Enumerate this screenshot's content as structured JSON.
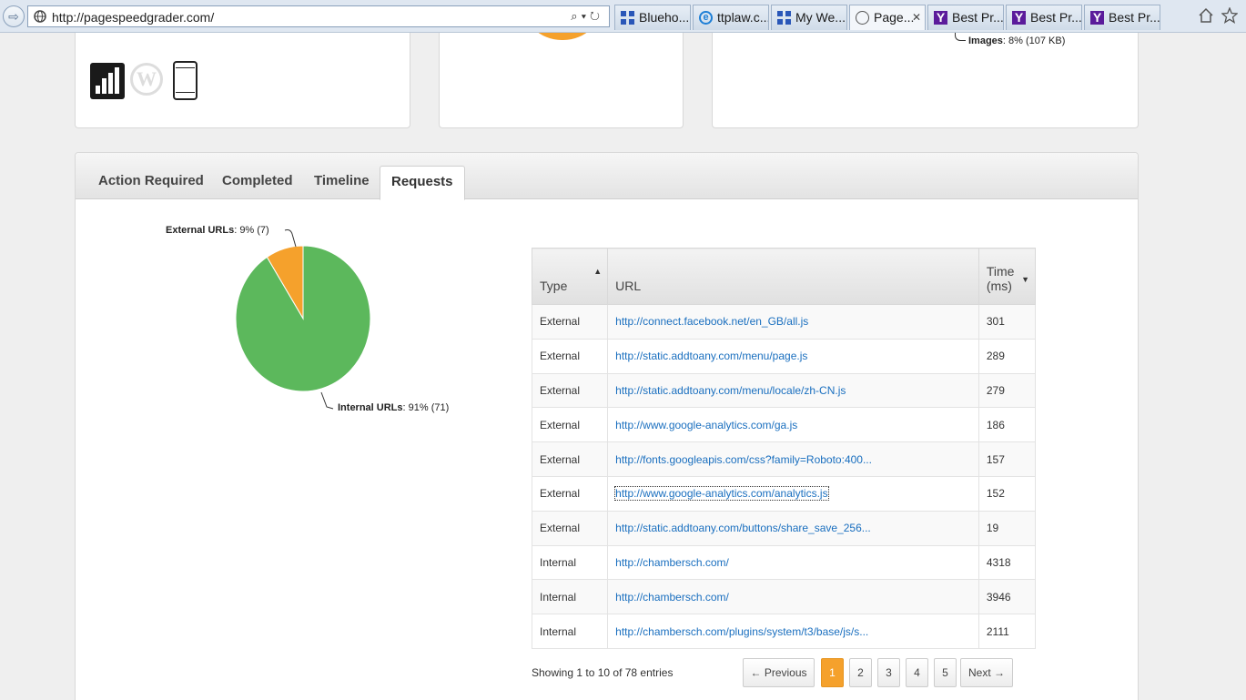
{
  "browser": {
    "address": "http://pagespeedgrader.com/",
    "tabs": [
      {
        "label": "Blueho...",
        "icon": "grid-icon"
      },
      {
        "label": "ttplaw.c...",
        "icon": "ie-icon"
      },
      {
        "label": "My We...",
        "icon": "grid-icon"
      },
      {
        "label": "Page...",
        "icon": "globe-icon",
        "active": true
      },
      {
        "label": "Best Pr...",
        "icon": "yahoo-icon"
      },
      {
        "label": "Best Pr...",
        "icon": "yahoo-icon"
      },
      {
        "label": "Best Pr...",
        "icon": "yahoo-icon"
      }
    ]
  },
  "top_cards": {
    "images_label_bold": "Images",
    "images_label_value": ": 8% (107 KB)"
  },
  "panel": {
    "tabs": [
      "Action Required",
      "Completed",
      "Timeline",
      "Requests"
    ],
    "active_tab": "Requests"
  },
  "chart_data": {
    "type": "pie",
    "slices": [
      {
        "name": "External URLs",
        "percent": 9,
        "count": 7,
        "color": "#f5a12c"
      },
      {
        "name": "Internal URLs",
        "percent": 91,
        "count": 71,
        "color": "#5cb85c"
      }
    ],
    "labels": {
      "external_bold": "External URLs",
      "external_value": ": 9% (7)",
      "internal_bold": "Internal URLs",
      "internal_value": ": 91% (71)"
    }
  },
  "table": {
    "headers": {
      "type": "Type",
      "url": "URL",
      "time_line1": "Time",
      "time_line2": "(ms)"
    },
    "rows": [
      {
        "type": "External",
        "url": "http://connect.facebook.net/en_GB/all.js",
        "time": "301"
      },
      {
        "type": "External",
        "url": "http://static.addtoany.com/menu/page.js",
        "time": "289"
      },
      {
        "type": "External",
        "url": "http://static.addtoany.com/menu/locale/zh-CN.js",
        "time": "279"
      },
      {
        "type": "External",
        "url": "http://www.google-analytics.com/ga.js",
        "time": "186"
      },
      {
        "type": "External",
        "url": "http://fonts.googleapis.com/css?family=Roboto:400...",
        "time": "157"
      },
      {
        "type": "External",
        "url": "http://www.google-analytics.com/analytics.js",
        "time": "152"
      },
      {
        "type": "External",
        "url": "http://static.addtoany.com/buttons/share_save_256...",
        "time": "19"
      },
      {
        "type": "Internal",
        "url": "http://chambersch.com/",
        "time": "4318"
      },
      {
        "type": "Internal",
        "url": "http://chambersch.com/",
        "time": "3946"
      },
      {
        "type": "Internal",
        "url": "http://chambersch.com/plugins/system/t3/base/js/s...",
        "time": "2111"
      }
    ]
  },
  "pagination": {
    "info": "Showing 1 to 10 of 78 entries",
    "previous": "← Previous",
    "pages": [
      "1",
      "2",
      "3",
      "4",
      "5"
    ],
    "current": "1",
    "next": "Next →"
  }
}
